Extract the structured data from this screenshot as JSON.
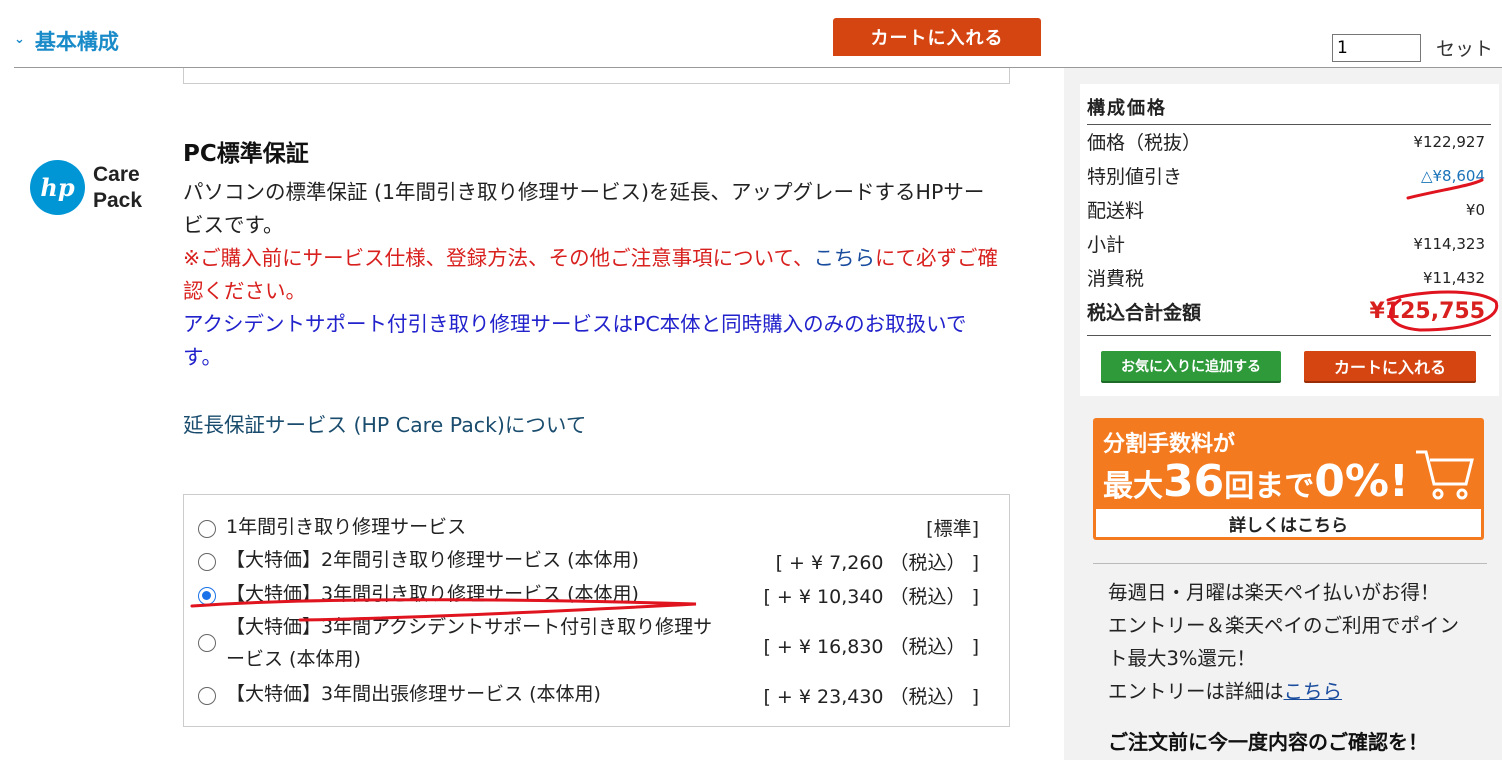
{
  "header": {
    "section_title": "基本構成",
    "cart_button": "カートに入れる",
    "quantity_value": "1",
    "quantity_unit": "セット"
  },
  "product": {
    "logo_text_line1": "Care",
    "logo_text_line2": "Pack",
    "logo_mark": "hp",
    "title": "PC標準保証",
    "description": "パソコンの標準保証 (1年間引き取り修理サービス)を延長、アップグレードするHPサービスです。",
    "notice_red_1": "※ご購入前にサービス仕様、登録方法、その他ご注意事項について、",
    "notice_link": "こちら",
    "notice_red_2": "にて必ずご確認ください。",
    "notice_blue": "アクシデントサポート付引き取り修理サービスはPC本体と同時購入のみのお取扱いです。",
    "about_link": "延長保証サービス (HP Care Pack)について"
  },
  "options": [
    {
      "label": "1年間引き取り修理サービス",
      "price": "[標準]",
      "checked": false
    },
    {
      "label": "【大特価】2年間引き取り修理サービス (本体用)",
      "price": "[ + ¥ 7,260 （税込） ]",
      "checked": false
    },
    {
      "label": "【大特価】3年間引き取り修理サービス (本体用)",
      "price": "[ + ¥ 10,340 （税込） ]",
      "checked": true
    },
    {
      "label": "【大特価】3年間アクシデントサポート付引き取り修理サービス (本体用)",
      "price": "[ + ¥ 16,830 （税込） ]",
      "checked": false
    },
    {
      "label": "【大特価】3年間出張修理サービス (本体用)",
      "price": "[ + ¥ 23,430 （税込） ]",
      "checked": false
    }
  ],
  "price_summary": {
    "heading": "構成価格",
    "rows": [
      {
        "label": "価格（税抜）",
        "value": "¥122,927"
      },
      {
        "label": "特別値引き",
        "value": "△¥8,604"
      },
      {
        "label": "配送料",
        "value": "¥0"
      },
      {
        "label": "小計",
        "value": "¥114,323"
      },
      {
        "label": "消費税",
        "value": "¥11,432"
      }
    ],
    "total_label": "税込合計金額",
    "total_value": "¥125,755",
    "favorite_button": "お気に入りに追加する",
    "cart_button": "カートに入れる"
  },
  "banner": {
    "line1": "分割手数料が",
    "line2a": "最大",
    "line2b": "36",
    "line2c": "回まで",
    "line2d": "0%!",
    "footer": "詳しくはこちら"
  },
  "info": {
    "line1": "毎週日・月曜は楽天ペイ払いがお得！",
    "line2": "エントリー＆楽天ペイのご利用でポイント最大3%還元！",
    "line3_prefix": "エントリーは詳細は",
    "line3_link": "こちら",
    "confirm": "ご注文前に今一度内容のご確認を！"
  },
  "colors": {
    "accent_blue": "#1a8bc9",
    "cart_orange": "#d54512",
    "favorite_green": "#2e9a3a",
    "total_red": "#d8201e",
    "banner_orange": "#f47a1f"
  }
}
